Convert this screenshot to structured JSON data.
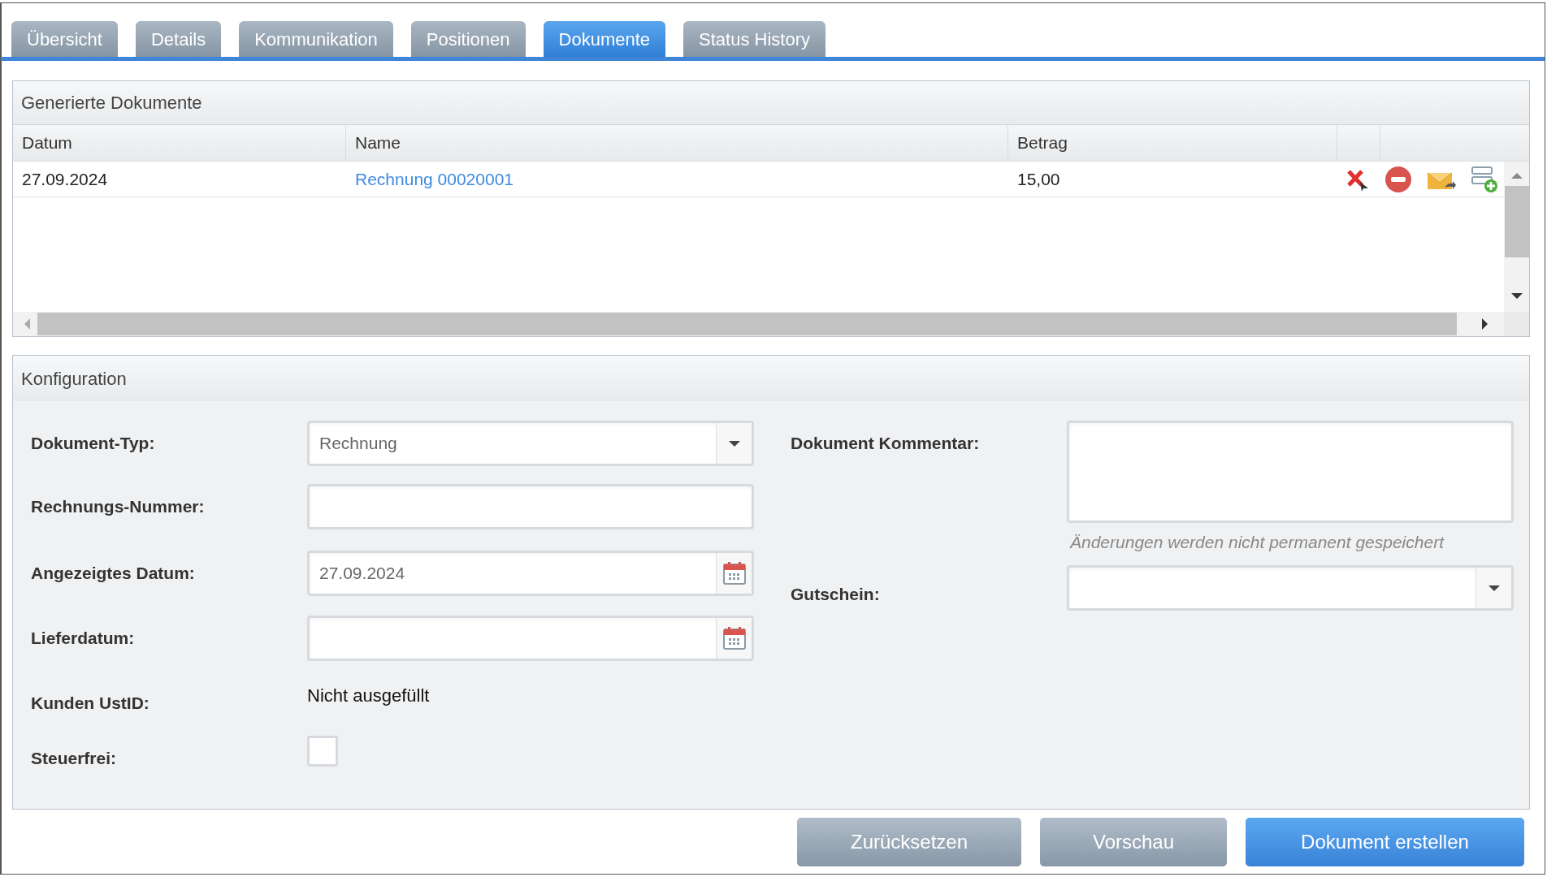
{
  "tabs": [
    {
      "label": "Übersicht",
      "selected": false
    },
    {
      "label": "Details",
      "selected": false
    },
    {
      "label": "Kommunikation",
      "selected": false
    },
    {
      "label": "Positionen",
      "selected": false
    },
    {
      "label": "Dokumente",
      "selected": true
    },
    {
      "label": "Status History",
      "selected": false
    }
  ],
  "documents_panel": {
    "title": "Generierte Dokumente",
    "columns": [
      "Datum",
      "Name",
      "Betrag"
    ],
    "rows": [
      {
        "datum": "27.09.2024",
        "name": "Rechnung 00020001",
        "betrag": "15,00"
      }
    ]
  },
  "config_panel": {
    "title": "Konfiguration",
    "left_fields": [
      {
        "kind": "select",
        "label": "Dokument-Typ:",
        "value": "Rechnung"
      },
      {
        "kind": "text",
        "label": "Rechnungs-Nummer:"
      },
      {
        "kind": "date",
        "label": "Angezeigtes Datum:",
        "value": "27.09.2024"
      },
      {
        "kind": "date",
        "label": "Lieferdatum:"
      },
      {
        "kind": "static",
        "label": "Kunden UstID:",
        "value": "Nicht ausgefüllt"
      },
      {
        "kind": "checkbox",
        "label": "Steuerfrei:",
        "checked": false
      }
    ],
    "right_fields": [
      {
        "kind": "textarea",
        "label": "Dokument Kommentar:",
        "hint": "Änderungen werden nicht permanent gespeichert"
      },
      {
        "kind": "select",
        "label": "Gutschein:"
      }
    ]
  },
  "buttons": [
    {
      "label": "Zurücksetzen",
      "kind": "secondary"
    },
    {
      "label": "Vorschau",
      "kind": "secondary"
    },
    {
      "label": "Dokument erstellen",
      "kind": "primary"
    }
  ]
}
